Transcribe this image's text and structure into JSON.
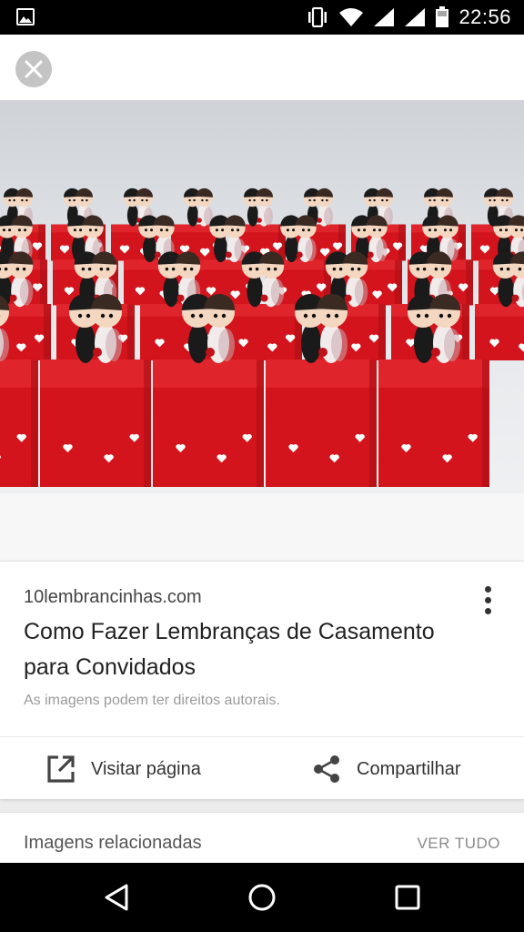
{
  "status_bar": {
    "time": "22:56",
    "icons": [
      "gallery-icon",
      "vibrate-icon",
      "wifi-icon",
      "signal-icon",
      "signal-icon",
      "battery-icon"
    ]
  },
  "viewer": {
    "close_icon": "close-icon"
  },
  "result": {
    "domain": "10lembrancinhas.com",
    "title": "Como Fazer Lembranças de Casamento para Convidados",
    "copyright_notice": "As imagens podem ter direitos autorais.",
    "visit_label": "Visitar página",
    "share_label": "Compartilhar"
  },
  "related": {
    "title": "Imagens relacionadas",
    "see_all": "VER TUDO"
  },
  "nav": {
    "icons": [
      "back-icon",
      "home-icon",
      "recents-icon"
    ]
  },
  "colors": {
    "box_red": "#d4141c",
    "background": "#ececec",
    "nav_bar": "#000000"
  }
}
